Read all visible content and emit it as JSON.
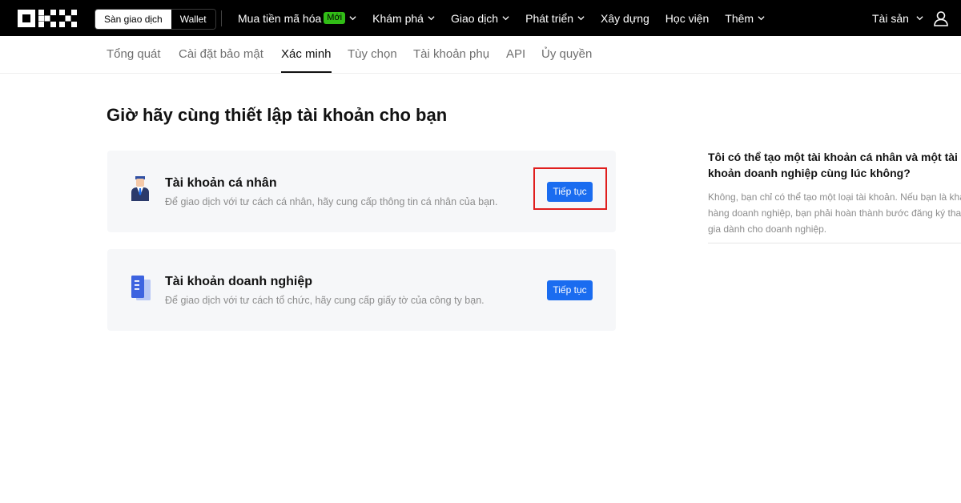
{
  "header": {
    "logo": "OKX",
    "switch": {
      "exchange_label": "Sàn giao dịch",
      "wallet_label": "Wallet"
    },
    "nav": [
      {
        "label": "Mua tiền mã hóa",
        "badge": "Mới",
        "has_dropdown": true
      },
      {
        "label": "Khám phá",
        "has_dropdown": true
      },
      {
        "label": "Giao dịch",
        "has_dropdown": true
      },
      {
        "label": "Phát triển",
        "has_dropdown": true
      },
      {
        "label": "Xây dựng",
        "has_dropdown": false
      },
      {
        "label": "Học viện",
        "has_dropdown": false
      },
      {
        "label": "Thêm",
        "has_dropdown": true
      }
    ],
    "assets_label": "Tài sản",
    "user_icon": "user-icon"
  },
  "subnav": {
    "tabs": [
      {
        "label": "Tổng quát",
        "active": false
      },
      {
        "label": "Cài đặt bảo mật",
        "active": false
      },
      {
        "label": "Xác minh",
        "active": true
      },
      {
        "label": "Tùy chọn",
        "active": false
      },
      {
        "label": "Tài khoản phụ",
        "active": false
      },
      {
        "label": "API",
        "active": false
      },
      {
        "label": "Ủy quyền",
        "active": false
      }
    ]
  },
  "main": {
    "title": "Giờ hãy cùng thiết lập tài khoản cho bạn",
    "cards": [
      {
        "icon": "person-icon",
        "title": "Tài khoản cá nhân",
        "description": "Để giao dịch với tư cách cá nhân, hãy cung cấp thông tin cá nhân của bạn.",
        "button_label": "Tiếp tục",
        "highlighted": true
      },
      {
        "icon": "document-icon",
        "title": "Tài khoản doanh nghiệp",
        "description": "Để giao dịch với tư cách tổ chức, hãy cung cấp giấy tờ của công ty bạn.",
        "button_label": "Tiếp tục",
        "highlighted": false
      }
    ]
  },
  "faq": {
    "question": "Tôi có thể tạo một tài khoản cá nhân và một tài khoản doanh nghiệp cùng lúc không?",
    "answer": "Không, bạn chỉ có thể tạo một loại tài khoản. Nếu bạn là khách hàng doanh nghiệp, bạn phải hoàn thành bước đăng ký tham gia dành cho doanh nghiệp."
  },
  "colors": {
    "topbar_bg": "#000000",
    "primary_button": "#1a6cf0",
    "new_badge": "#31bd16",
    "highlight_border": "#e01e1e",
    "card_bg": "#f6f7f9"
  }
}
